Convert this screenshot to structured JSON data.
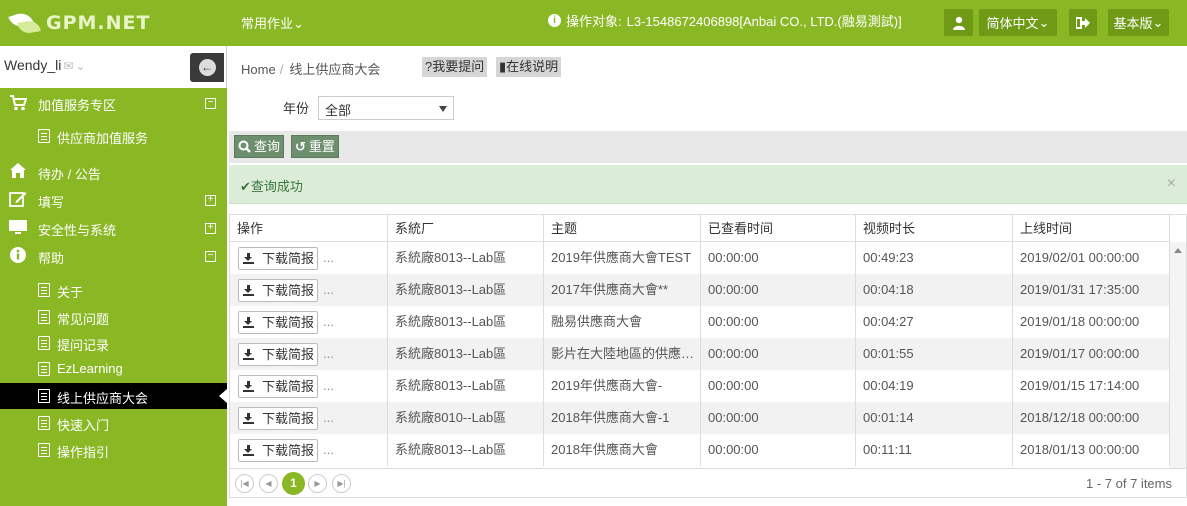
{
  "app": {
    "logo_text": "GPM.NET",
    "top_menu": "常用作业",
    "target_label": "操作对象:",
    "target_value": "L3-1548672406898[Anbai CO., LTD.(融易測試)]",
    "language": "简体中文",
    "version": "基本版",
    "accent_color": "#8ab825"
  },
  "sidebar": {
    "user_name": "Wendy_li",
    "sections": [
      {
        "label": "加值服务专区",
        "icon": "cart-icon",
        "toggle": "⊟"
      },
      {
        "label": "待办 / 公告",
        "icon": "home-icon",
        "toggle": ""
      },
      {
        "label": "填写",
        "icon": "edit-icon",
        "toggle": "⊞"
      },
      {
        "label": "安全性与系统",
        "icon": "monitor-icon",
        "toggle": "⊞"
      },
      {
        "label": "帮助",
        "icon": "info-icon",
        "toggle": "⊟"
      }
    ],
    "value_service_item": "供应商加值服务",
    "help_items": [
      {
        "label": "关于"
      },
      {
        "label": "常见问题"
      },
      {
        "label": "提问记录"
      },
      {
        "label": "EzLearning"
      },
      {
        "label": "线上供应商大会"
      },
      {
        "label": "快速入门"
      },
      {
        "label": "操作指引"
      }
    ]
  },
  "breadcrumb": {
    "home": "Home",
    "current": "线上供应商大会",
    "ask_button": "?我要提问",
    "online_help_button": "在线说明"
  },
  "filter": {
    "year_label": "年份",
    "year_value": "全部"
  },
  "toolbar": {
    "query_label": "查询",
    "reset_label": "重置"
  },
  "alert": {
    "message": "查询成功"
  },
  "grid": {
    "columns": [
      "操作",
      "系統厂",
      "主题",
      "已查看时间",
      "视频时长",
      "上线时间"
    ],
    "download_label": "下载简报",
    "ellipsis": "...",
    "rows": [
      {
        "factory": "系統廠8013--Lab區",
        "subject": "2019年供應商大會TEST",
        "viewed": "00:00:00",
        "duration": "00:49:23",
        "online": "2019/02/01 00:00:00"
      },
      {
        "factory": "系統廠8013--Lab區",
        "subject": "2017年供應商大會**",
        "viewed": "00:00:00",
        "duration": "00:04:18",
        "online": "2019/01/31 17:35:00"
      },
      {
        "factory": "系統廠8013--Lab區",
        "subject": "融易供應商大會",
        "viewed": "00:00:00",
        "duration": "00:04:27",
        "online": "2019/01/18 00:00:00"
      },
      {
        "factory": "系統廠8013--Lab區",
        "subject": "影片在大陸地區的供應商大會",
        "viewed": "00:00:00",
        "duration": "00:01:55",
        "online": "2019/01/17 00:00:00"
      },
      {
        "factory": "系統廠8013--Lab區",
        "subject": "2019年供應商大會-",
        "viewed": "00:00:00",
        "duration": "00:04:19",
        "online": "2019/01/15 17:14:00"
      },
      {
        "factory": "系統廠8010--Lab區",
        "subject": "2018年供應商大會-1",
        "viewed": "00:00:00",
        "duration": "00:01:14",
        "online": "2018/12/18 00:00:00"
      },
      {
        "factory": "系統廠8013--Lab區",
        "subject": "2018年供應商大會",
        "viewed": "00:00:00",
        "duration": "00:11:11",
        "online": "2018/01/13 00:00:00"
      }
    ]
  },
  "pager": {
    "current_page": "1",
    "info": "1 - 7 of 7 items"
  }
}
